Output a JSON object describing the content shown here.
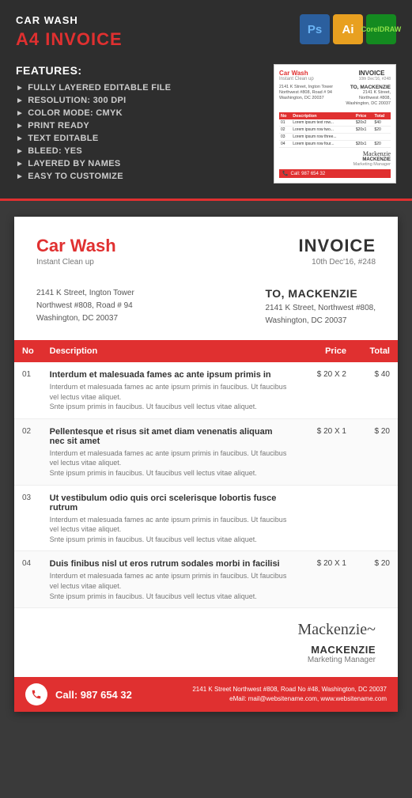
{
  "header": {
    "top_label": "CAR WASH",
    "main_title": "A4 INVOICE",
    "badges": [
      {
        "label": "Ps",
        "type": "ps"
      },
      {
        "label": "Ai",
        "type": "ai"
      },
      {
        "label": "CorelDRAW",
        "type": "cd",
        "display": "CD"
      }
    ]
  },
  "features": {
    "heading": "FEATURES:",
    "items": [
      "FULLY LAYERED EDITABLE FILE",
      "RESOLUTION: 300 DPI",
      "COLOR MODE: CMYK",
      "PRINT READY",
      "TEXT EDITABLE",
      "BLEED: YES",
      "LAYERED BY NAMES",
      "EASY TO CUSTOMIZE"
    ]
  },
  "invoice": {
    "company_name": "Car Wash",
    "company_sub": "Instant Clean up",
    "title": "INVOICE",
    "date": "10th Dec'16, #248",
    "from_address_line1": "2141 K Street, Ington Tower",
    "from_address_line2": "Northwest #808, Road # 94",
    "from_address_line3": "Washington, DC 20037",
    "to_label": "TO, MACKENZIE",
    "to_address_line1": "2141 K Street, Northwest #808,",
    "to_address_line2": "Washington, DC 20037",
    "table": {
      "headers": [
        "No",
        "Description",
        "Price",
        "Total"
      ],
      "rows": [
        {
          "no": "01",
          "desc_main": "Interdum et malesuada fames ac ante ipsum primis in",
          "desc_sub": "Interdum et malesuada fames ac ante ipsum primis in faucibus. Ut faucibus vel lectus vitae aliquet. Snte ipsum primis in faucibus. Ut faucibus vell lectus vitae aliquet.",
          "price": "$ 20 X 2",
          "total": "$ 40"
        },
        {
          "no": "02",
          "desc_main": "Pellentesque et risus sit amet diam venenatis aliquam nec sit amet",
          "desc_sub": "Interdum et malesuada fames ac ante ipsum primis in faucibus. Ut faucibus vel lectus vitae aliquet. Snte ipsum primis in faucibus. Ut faucibus vell lectus vitae aliquet.",
          "price": "$ 20 X 1",
          "total": "$ 20"
        },
        {
          "no": "03",
          "desc_main": "Ut vestibulum odio quis orci scelerisque lobortis fusce rutrum",
          "desc_sub": "Interdum et malesuada fames ac ante ipsum primis in faucibus. Ut faucibus vel lectus vitae aliquet. Snte ipsum primis in faucibus. Ut faucibus vell lectus vitae aliquet.",
          "price": "",
          "total": ""
        },
        {
          "no": "04",
          "desc_main": "Duis finibus nisl ut eros rutrum sodales morbi in facilisi",
          "desc_sub": "Interdum et malesuada fames ac ante ipsum primis in faucibus. Ut faucibus vel lectus vitae aliquet. Snte ipsum primis in faucibus. Ut faucibus vell lectus vitae aliquet.",
          "price": "$ 20 X 1",
          "total": "$ 20"
        }
      ]
    },
    "signature_name": "MACKENZIE",
    "signature_role": "Marketing Manager",
    "footer_call": "Call: 987 654 32",
    "footer_address": "2141 K Street Northwest #808,  Road No #48, Washington, DC 20037",
    "footer_email": "eMail: mail@websitename.com, www.websitename.com"
  }
}
